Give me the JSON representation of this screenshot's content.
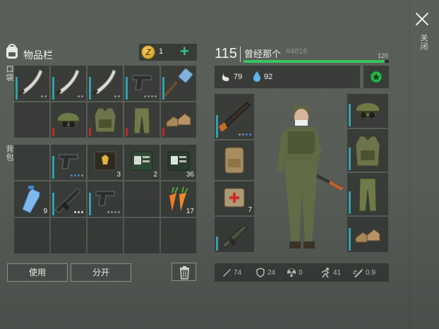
{
  "window": {
    "close_label": "关闭"
  },
  "inventory": {
    "title": "物品栏",
    "coins": "1",
    "pocket_label": "口袋",
    "bag_label": "背包",
    "use_button": "使用",
    "split_button": "分开"
  },
  "pockets": [
    {
      "icon": "machete-icon"
    },
    {
      "icon": "machete-icon"
    },
    {
      "icon": "machete-icon"
    },
    {
      "icon": "pistol-icon"
    },
    {
      "icon": "sledgehammer-icon"
    }
  ],
  "gear_row": [
    {
      "icon": "empty"
    },
    {
      "icon": "camo-cap-icon"
    },
    {
      "icon": "camo-vest-icon"
    },
    {
      "icon": "camo-pants-icon"
    },
    {
      "icon": "boots-icon"
    }
  ],
  "backpack": [
    {
      "icon": "empty",
      "count": ""
    },
    {
      "icon": "pistol-icon",
      "count": ""
    },
    {
      "icon": "police-badge-icon",
      "count": "3"
    },
    {
      "icon": "id-card-icon",
      "count": "2"
    },
    {
      "icon": "id-card-icon",
      "count": "36"
    },
    {
      "icon": "water-bottle-icon",
      "count": "9"
    },
    {
      "icon": "rifle-icon",
      "count": ""
    },
    {
      "icon": "pistol-icon",
      "count": ""
    },
    {
      "icon": "empty",
      "count": ""
    },
    {
      "icon": "carrot-icon",
      "count": "17"
    }
  ],
  "character": {
    "level": "115",
    "name": "曾经那个",
    "id": "#4816",
    "xp_label": "120",
    "xp_fraction": 0.97,
    "hunger": "79",
    "thirst": "92",
    "weapon_slots": [
      {
        "icon": "shotgun-icon",
        "count": ""
      },
      {
        "icon": "tactical-backpack-icon",
        "count": ""
      },
      {
        "icon": "medkit-bag-icon",
        "count": "7"
      },
      {
        "icon": "grenade-launcher-icon",
        "count": ""
      }
    ],
    "armor_slots": [
      {
        "icon": "camo-cap-icon"
      },
      {
        "icon": "camo-vest-icon"
      },
      {
        "icon": "camo-pants-icon"
      },
      {
        "icon": "boots-icon"
      }
    ],
    "stats": {
      "attack": "74",
      "defense": "24",
      "radiation": "0",
      "speed": "41",
      "attack_speed": "0.9"
    }
  },
  "colors": {
    "accent": "#36c75d",
    "durability": "#2fa3a9",
    "low_durability": "#c0292c",
    "coin": "#e0b030"
  }
}
